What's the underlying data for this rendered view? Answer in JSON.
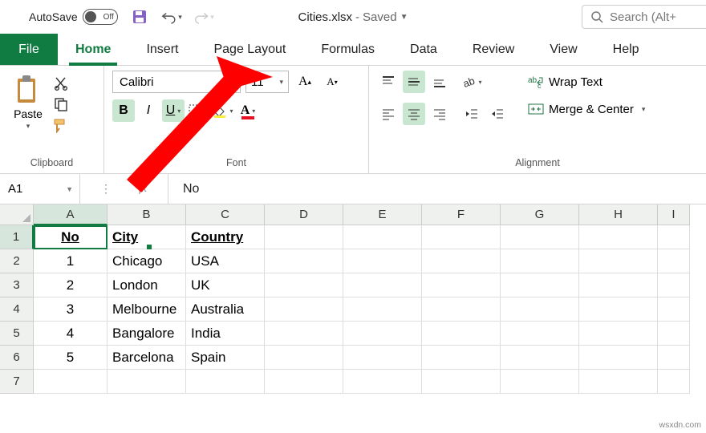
{
  "titlebar": {
    "autosave_label": "AutoSave",
    "autosave_state": "Off",
    "filename": "Cities.xlsx",
    "save_state": "Saved",
    "search_placeholder": "Search (Alt+"
  },
  "tabs": {
    "file": "File",
    "items": [
      "Home",
      "Insert",
      "Page Layout",
      "Formulas",
      "Data",
      "Review",
      "View",
      "Help"
    ],
    "active": "Home"
  },
  "ribbon": {
    "clipboard": {
      "paste": "Paste",
      "label": "Clipboard"
    },
    "font": {
      "name": "Calibri",
      "size": "11",
      "bold": "B",
      "italic": "I",
      "underline": "U",
      "label": "Font"
    },
    "alignment": {
      "wrap": "Wrap Text",
      "merge": "Merge & Center",
      "label": "Alignment"
    }
  },
  "namebar": {
    "cell_ref": "A1",
    "formula": "No"
  },
  "columns": [
    "A",
    "B",
    "C",
    "D",
    "E",
    "F",
    "G",
    "H",
    "I"
  ],
  "rows": [
    {
      "n": "1",
      "cells": [
        "No",
        "City",
        "Country",
        "",
        "",
        "",
        "",
        "",
        ""
      ],
      "header": true
    },
    {
      "n": "2",
      "cells": [
        "1",
        "Chicago",
        "USA",
        "",
        "",
        "",
        "",
        "",
        ""
      ]
    },
    {
      "n": "3",
      "cells": [
        "2",
        "London",
        "UK",
        "",
        "",
        "",
        "",
        "",
        ""
      ]
    },
    {
      "n": "4",
      "cells": [
        "3",
        "Melbourne",
        "Australia",
        "",
        "",
        "",
        "",
        "",
        ""
      ]
    },
    {
      "n": "5",
      "cells": [
        "4",
        "Bangalore",
        "India",
        "",
        "",
        "",
        "",
        "",
        ""
      ]
    },
    {
      "n": "6",
      "cells": [
        "5",
        "Barcelona",
        "Spain",
        "",
        "",
        "",
        "",
        "",
        ""
      ]
    },
    {
      "n": "7",
      "cells": [
        "",
        "",
        "",
        "",
        "",
        "",
        "",
        "",
        ""
      ]
    }
  ],
  "source_url": "wsxdn.com"
}
